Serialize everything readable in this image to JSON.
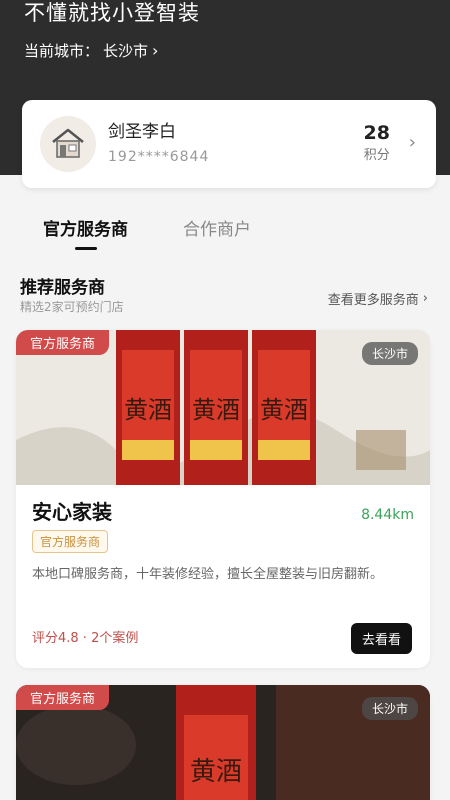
{
  "header": {
    "title": "不懂就找小登智装",
    "city_label": "当前城市：",
    "city_value": "长沙市",
    "city_chevron": "›"
  },
  "user": {
    "name": "剑圣李白",
    "phone": "192****6844",
    "points_value": "28",
    "points_label": "积分",
    "avatar_icon": "house-icon"
  },
  "tabs": [
    {
      "label": "官方服务商",
      "active": true
    },
    {
      "label": "合作商户",
      "active": false
    }
  ],
  "section": {
    "title": "推荐服务商",
    "subtitle": "精选2家可预约门店",
    "more": "查看更多服务商"
  },
  "vendors": [
    {
      "tag": "官方服务商",
      "city": "长沙市",
      "name": "安心家装",
      "distance": "8.44km",
      "badge": "官方服务商",
      "description": "本地口碑服务商，十年装修经验，擅长全屋整装与旧房翻新。",
      "rating": "评分4.8 · 2个案例",
      "button": "去看看",
      "banner_text": "黄酒"
    },
    {
      "tag": "官方服务商",
      "city": "长沙市",
      "banner_text": "黄酒"
    }
  ],
  "colors": {
    "header_bg": "#2d2d2d",
    "tag_red": "#d24b4b",
    "distance_green": "#3aa35a",
    "rating_red": "#c0504d"
  }
}
